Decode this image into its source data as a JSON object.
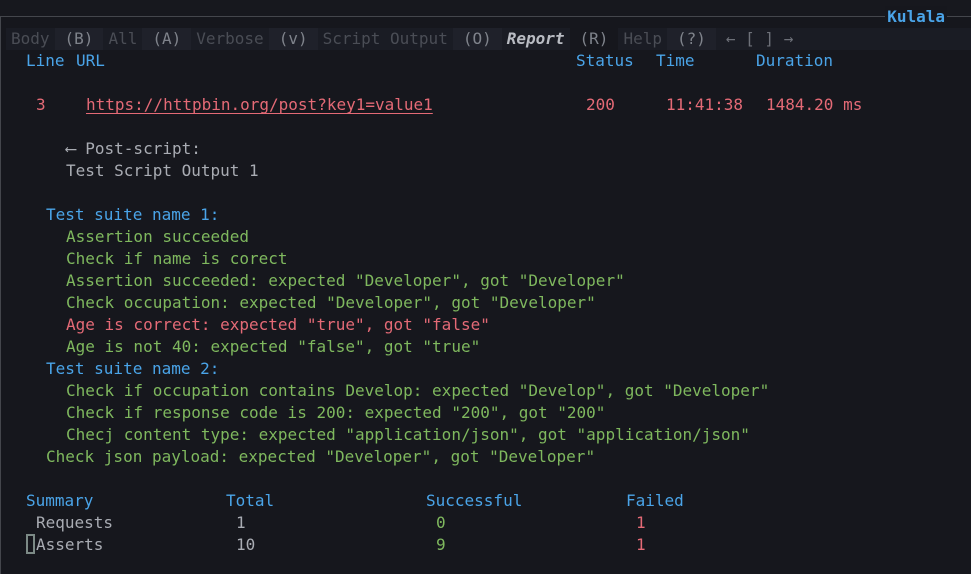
{
  "window": {
    "title": "Kulala"
  },
  "tabs": [
    {
      "label": "Body",
      "key": "(B)",
      "active": false
    },
    {
      "label": "All",
      "key": "(A)",
      "active": false
    },
    {
      "label": "Verbose",
      "key": "(v)",
      "active": false
    },
    {
      "label": "Script Output",
      "key": "(O)",
      "active": false
    },
    {
      "label": "Report",
      "key": "(R)",
      "active": true
    },
    {
      "label": "Help",
      "key": "(?)",
      "active": false
    }
  ],
  "nav": {
    "prev": "←",
    "brackets": "[ ]",
    "next": "→"
  },
  "report_table": {
    "headers": {
      "line": "Line",
      "url": "URL",
      "status": "Status",
      "time": "Time",
      "duration": "Duration"
    },
    "rows": [
      {
        "line": "3",
        "url": "https://httpbin.org/post?key1=value1",
        "status": "200",
        "time": "11:41:38",
        "duration": "1484.20 ms"
      }
    ]
  },
  "post_script": {
    "label": "⟵ Post-script:",
    "output": "Test Script Output 1"
  },
  "test_suites": [
    {
      "name": "Test suite name 1:",
      "results": [
        {
          "text": "Assertion succeeded",
          "status": "pass"
        },
        {
          "text": "Check if name is corect",
          "status": "pass"
        },
        {
          "text": "Assertion succeeded: expected \"Developer\", got \"Developer\"",
          "status": "pass"
        },
        {
          "text": "Check occupation: expected \"Developer\", got \"Developer\"",
          "status": "pass"
        },
        {
          "text": "Age is correct: expected \"true\", got \"false\"",
          "status": "fail"
        },
        {
          "text": "Age is not 40: expected \"false\", got \"true\"",
          "status": "pass"
        }
      ]
    },
    {
      "name": "Test suite name 2:",
      "results": [
        {
          "text": "Check if occupation contains Develop: expected \"Develop\", got \"Developer\"",
          "status": "pass"
        },
        {
          "text": "Check if response code is 200: expected \"200\", got \"200\"",
          "status": "pass"
        },
        {
          "text": "Checj content type: expected \"application/json\", got \"application/json\"",
          "status": "pass"
        }
      ]
    }
  ],
  "standalone_assertion": {
    "text": "Check json payload: expected \"Developer\", got \"Developer\"",
    "status": "pass"
  },
  "summary": {
    "headers": {
      "label": "Summary",
      "total": "Total",
      "successful": "Successful",
      "failed": "Failed"
    },
    "rows": [
      {
        "label": "Requests",
        "total": "1",
        "successful": "0",
        "failed": "1"
      },
      {
        "label": "Asserts",
        "total": "10",
        "successful": "9",
        "failed": "1"
      }
    ]
  },
  "colors": {
    "accent": "#4aa4e8",
    "fail": "#e46a76",
    "pass": "#7fb85e",
    "text": "#a9acb3",
    "background": "#16171d"
  }
}
